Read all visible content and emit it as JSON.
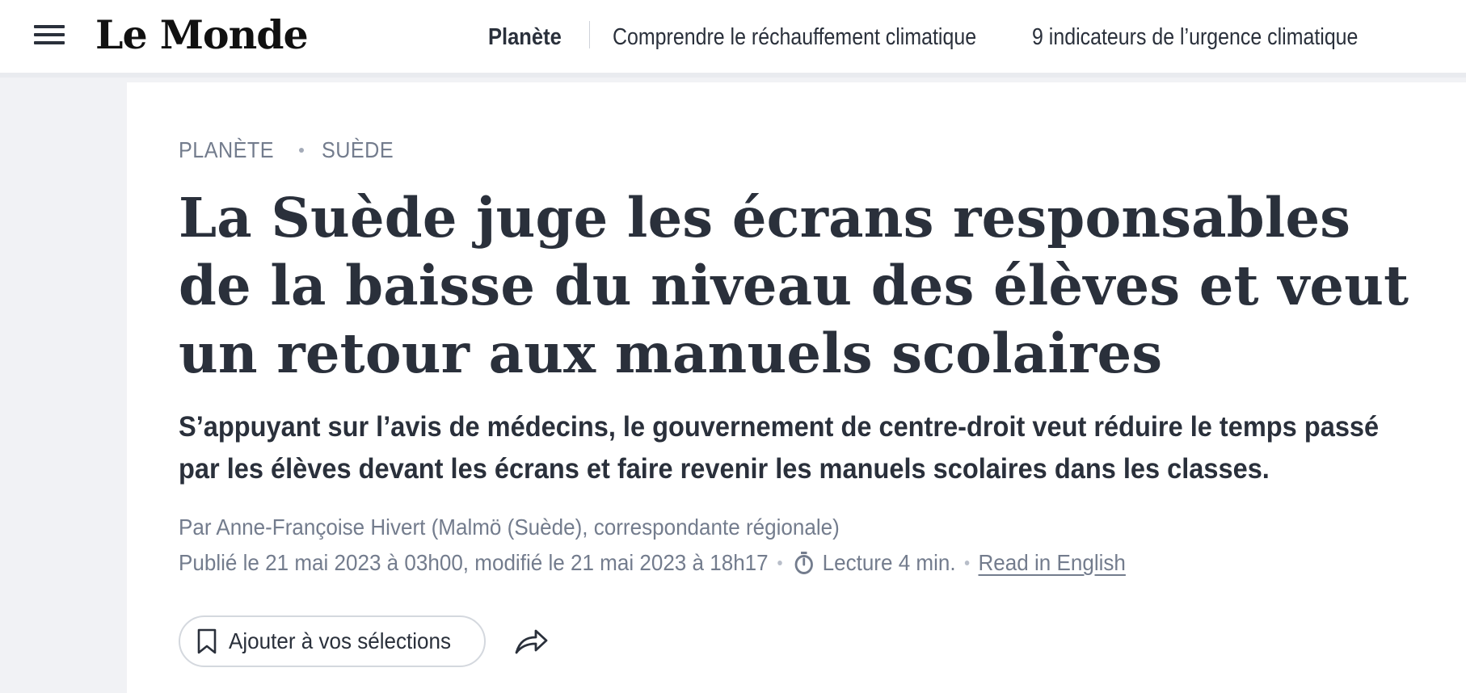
{
  "header": {
    "logo": "Le Monde",
    "nav": {
      "section": "Planète",
      "link1": "Comprendre le réchauffement climatique",
      "link2": "9 indicateurs de l’urgence climatique"
    }
  },
  "article": {
    "kicker": [
      "PLANÈTE",
      "SUÈDE"
    ],
    "headline": "La Suède juge les écrans responsables de la baisse du niveau des élèves et veut un retour aux manuels scolaires",
    "standfirst": "S’appuyant sur l’avis de médecins, le gouvernement de centre-droit veut réduire le temps passé par les élèves devant les écrans et faire revenir les manuels scolaires dans les classes.",
    "byline": "Par Anne-Françoise Hivert (Malmö (Suède), correspondante régionale)",
    "published": "Publié le 21 mai 2023 à 03h00, modifié le 21 mai 2023 à 18h17",
    "reading_time": "Lecture 4 min.",
    "read_in_english": "Read in English",
    "save_label": "Ajouter à vos sélections"
  },
  "icons": {
    "menu": "hamburger-menu-icon",
    "timer": "stopwatch-icon",
    "bookmark": "bookmark-icon",
    "share": "share-arrow-icon"
  }
}
